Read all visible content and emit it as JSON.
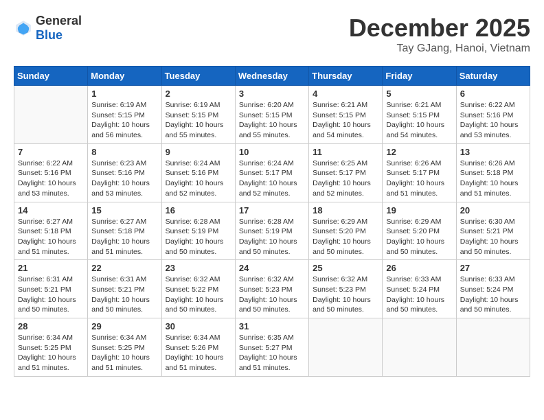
{
  "header": {
    "logo_general": "General",
    "logo_blue": "Blue",
    "month_title": "December 2025",
    "location": "Tay GJang, Hanoi, Vietnam"
  },
  "days_of_week": [
    "Sunday",
    "Monday",
    "Tuesday",
    "Wednesday",
    "Thursday",
    "Friday",
    "Saturday"
  ],
  "weeks": [
    [
      {
        "day": "",
        "info": ""
      },
      {
        "day": "1",
        "info": "Sunrise: 6:19 AM\nSunset: 5:15 PM\nDaylight: 10 hours\nand 56 minutes."
      },
      {
        "day": "2",
        "info": "Sunrise: 6:19 AM\nSunset: 5:15 PM\nDaylight: 10 hours\nand 55 minutes."
      },
      {
        "day": "3",
        "info": "Sunrise: 6:20 AM\nSunset: 5:15 PM\nDaylight: 10 hours\nand 55 minutes."
      },
      {
        "day": "4",
        "info": "Sunrise: 6:21 AM\nSunset: 5:15 PM\nDaylight: 10 hours\nand 54 minutes."
      },
      {
        "day": "5",
        "info": "Sunrise: 6:21 AM\nSunset: 5:15 PM\nDaylight: 10 hours\nand 54 minutes."
      },
      {
        "day": "6",
        "info": "Sunrise: 6:22 AM\nSunset: 5:16 PM\nDaylight: 10 hours\nand 53 minutes."
      }
    ],
    [
      {
        "day": "7",
        "info": "Sunrise: 6:22 AM\nSunset: 5:16 PM\nDaylight: 10 hours\nand 53 minutes."
      },
      {
        "day": "8",
        "info": "Sunrise: 6:23 AM\nSunset: 5:16 PM\nDaylight: 10 hours\nand 53 minutes."
      },
      {
        "day": "9",
        "info": "Sunrise: 6:24 AM\nSunset: 5:16 PM\nDaylight: 10 hours\nand 52 minutes."
      },
      {
        "day": "10",
        "info": "Sunrise: 6:24 AM\nSunset: 5:17 PM\nDaylight: 10 hours\nand 52 minutes."
      },
      {
        "day": "11",
        "info": "Sunrise: 6:25 AM\nSunset: 5:17 PM\nDaylight: 10 hours\nand 52 minutes."
      },
      {
        "day": "12",
        "info": "Sunrise: 6:26 AM\nSunset: 5:17 PM\nDaylight: 10 hours\nand 51 minutes."
      },
      {
        "day": "13",
        "info": "Sunrise: 6:26 AM\nSunset: 5:18 PM\nDaylight: 10 hours\nand 51 minutes."
      }
    ],
    [
      {
        "day": "14",
        "info": "Sunrise: 6:27 AM\nSunset: 5:18 PM\nDaylight: 10 hours\nand 51 minutes."
      },
      {
        "day": "15",
        "info": "Sunrise: 6:27 AM\nSunset: 5:18 PM\nDaylight: 10 hours\nand 51 minutes."
      },
      {
        "day": "16",
        "info": "Sunrise: 6:28 AM\nSunset: 5:19 PM\nDaylight: 10 hours\nand 50 minutes."
      },
      {
        "day": "17",
        "info": "Sunrise: 6:28 AM\nSunset: 5:19 PM\nDaylight: 10 hours\nand 50 minutes."
      },
      {
        "day": "18",
        "info": "Sunrise: 6:29 AM\nSunset: 5:20 PM\nDaylight: 10 hours\nand 50 minutes."
      },
      {
        "day": "19",
        "info": "Sunrise: 6:29 AM\nSunset: 5:20 PM\nDaylight: 10 hours\nand 50 minutes."
      },
      {
        "day": "20",
        "info": "Sunrise: 6:30 AM\nSunset: 5:21 PM\nDaylight: 10 hours\nand 50 minutes."
      }
    ],
    [
      {
        "day": "21",
        "info": "Sunrise: 6:31 AM\nSunset: 5:21 PM\nDaylight: 10 hours\nand 50 minutes."
      },
      {
        "day": "22",
        "info": "Sunrise: 6:31 AM\nSunset: 5:21 PM\nDaylight: 10 hours\nand 50 minutes."
      },
      {
        "day": "23",
        "info": "Sunrise: 6:32 AM\nSunset: 5:22 PM\nDaylight: 10 hours\nand 50 minutes."
      },
      {
        "day": "24",
        "info": "Sunrise: 6:32 AM\nSunset: 5:23 PM\nDaylight: 10 hours\nand 50 minutes."
      },
      {
        "day": "25",
        "info": "Sunrise: 6:32 AM\nSunset: 5:23 PM\nDaylight: 10 hours\nand 50 minutes."
      },
      {
        "day": "26",
        "info": "Sunrise: 6:33 AM\nSunset: 5:24 PM\nDaylight: 10 hours\nand 50 minutes."
      },
      {
        "day": "27",
        "info": "Sunrise: 6:33 AM\nSunset: 5:24 PM\nDaylight: 10 hours\nand 50 minutes."
      }
    ],
    [
      {
        "day": "28",
        "info": "Sunrise: 6:34 AM\nSunset: 5:25 PM\nDaylight: 10 hours\nand 51 minutes."
      },
      {
        "day": "29",
        "info": "Sunrise: 6:34 AM\nSunset: 5:25 PM\nDaylight: 10 hours\nand 51 minutes."
      },
      {
        "day": "30",
        "info": "Sunrise: 6:34 AM\nSunset: 5:26 PM\nDaylight: 10 hours\nand 51 minutes."
      },
      {
        "day": "31",
        "info": "Sunrise: 6:35 AM\nSunset: 5:27 PM\nDaylight: 10 hours\nand 51 minutes."
      },
      {
        "day": "",
        "info": ""
      },
      {
        "day": "",
        "info": ""
      },
      {
        "day": "",
        "info": ""
      }
    ]
  ]
}
